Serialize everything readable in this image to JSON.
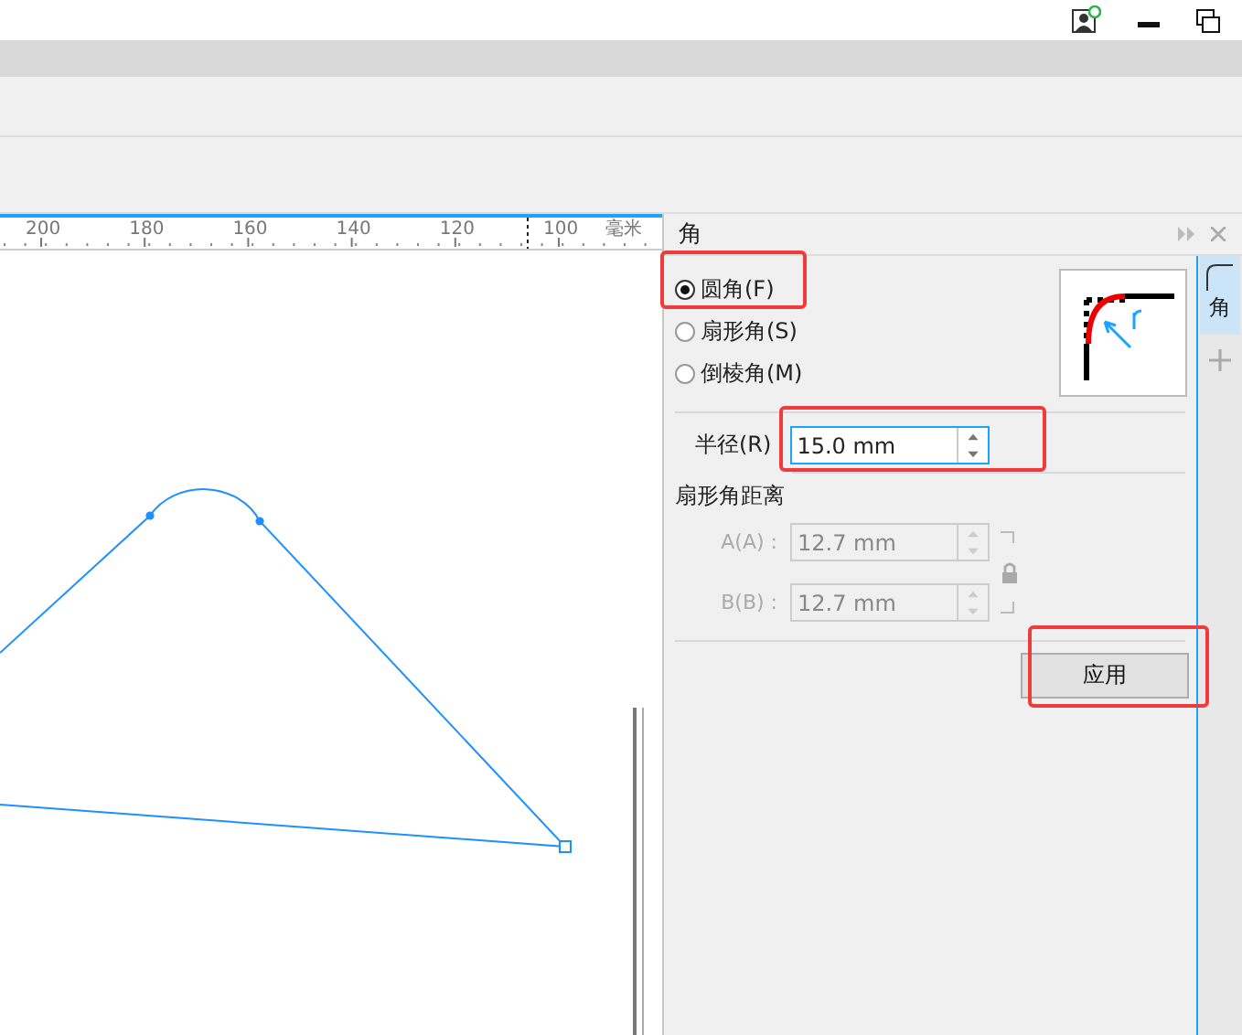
{
  "ruler": {
    "labels": [
      "200",
      "180",
      "160",
      "140",
      "120",
      "100",
      "毫米"
    ]
  },
  "panel": {
    "title": "角",
    "options": [
      {
        "label": "圆角(F)",
        "selected": true
      },
      {
        "label": "扇形角(S)",
        "selected": false
      },
      {
        "label": "倒棱角(M)",
        "selected": false
      }
    ],
    "radius": {
      "label": "半径(R)",
      "value": "15.0 mm"
    },
    "section": "扇形角距离",
    "distances": [
      {
        "label": "A(A) :",
        "value": "12.7 mm",
        "disabled": true
      },
      {
        "label": "B(B) :",
        "value": "12.7 mm",
        "disabled": true
      }
    ],
    "apply": "应用",
    "side_tab": {
      "label": "角",
      "selected": true
    }
  }
}
